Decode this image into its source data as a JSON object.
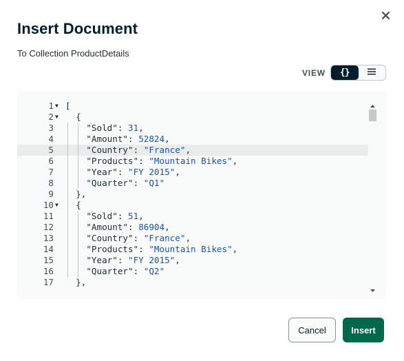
{
  "modal": {
    "title": "Insert Document",
    "subtitle": "To Collection ProductDetails",
    "close_icon": "close-icon"
  },
  "view_toggle": {
    "label": "VIEW",
    "options": [
      {
        "icon": "json-braces-icon",
        "glyph": "{}",
        "active": true
      },
      {
        "icon": "list-icon",
        "active": false
      }
    ]
  },
  "editor": {
    "highlighted_line": 5,
    "lines": [
      {
        "num": "1",
        "fold": true,
        "parts": [
          {
            "t": "p",
            "v": "["
          }
        ]
      },
      {
        "num": "2",
        "fold": true,
        "parts": [
          {
            "t": "p",
            "v": "  {"
          }
        ]
      },
      {
        "num": "3",
        "fold": false,
        "parts": [
          {
            "t": "p",
            "v": "    "
          },
          {
            "t": "k",
            "v": "\"Sold\""
          },
          {
            "t": "p",
            "v": ": "
          },
          {
            "t": "n",
            "v": "31"
          },
          {
            "t": "p",
            "v": ","
          }
        ]
      },
      {
        "num": "4",
        "fold": false,
        "parts": [
          {
            "t": "p",
            "v": "    "
          },
          {
            "t": "k",
            "v": "\"Amount\""
          },
          {
            "t": "p",
            "v": ": "
          },
          {
            "t": "n",
            "v": "52824"
          },
          {
            "t": "p",
            "v": ","
          }
        ]
      },
      {
        "num": "5",
        "fold": false,
        "parts": [
          {
            "t": "p",
            "v": "    "
          },
          {
            "t": "k",
            "v": "\"Country\""
          },
          {
            "t": "p",
            "v": ": "
          },
          {
            "t": "s",
            "v": "\"France\""
          },
          {
            "t": "p",
            "v": ","
          }
        ]
      },
      {
        "num": "6",
        "fold": false,
        "parts": [
          {
            "t": "p",
            "v": "    "
          },
          {
            "t": "k",
            "v": "\"Products\""
          },
          {
            "t": "p",
            "v": ": "
          },
          {
            "t": "s",
            "v": "\"Mountain Bikes\""
          },
          {
            "t": "p",
            "v": ","
          }
        ]
      },
      {
        "num": "7",
        "fold": false,
        "parts": [
          {
            "t": "p",
            "v": "    "
          },
          {
            "t": "k",
            "v": "\"Year\""
          },
          {
            "t": "p",
            "v": ": "
          },
          {
            "t": "s",
            "v": "\"FY 2015\""
          },
          {
            "t": "p",
            "v": ","
          }
        ]
      },
      {
        "num": "8",
        "fold": false,
        "parts": [
          {
            "t": "p",
            "v": "    "
          },
          {
            "t": "k",
            "v": "\"Quarter\""
          },
          {
            "t": "p",
            "v": ": "
          },
          {
            "t": "s",
            "v": "\"Q1\""
          }
        ]
      },
      {
        "num": "9",
        "fold": false,
        "parts": [
          {
            "t": "p",
            "v": "  },"
          }
        ]
      },
      {
        "num": "10",
        "fold": true,
        "parts": [
          {
            "t": "p",
            "v": "  {"
          }
        ]
      },
      {
        "num": "11",
        "fold": false,
        "parts": [
          {
            "t": "p",
            "v": "    "
          },
          {
            "t": "k",
            "v": "\"Sold\""
          },
          {
            "t": "p",
            "v": ": "
          },
          {
            "t": "n",
            "v": "51"
          },
          {
            "t": "p",
            "v": ","
          }
        ]
      },
      {
        "num": "12",
        "fold": false,
        "parts": [
          {
            "t": "p",
            "v": "    "
          },
          {
            "t": "k",
            "v": "\"Amount\""
          },
          {
            "t": "p",
            "v": ": "
          },
          {
            "t": "n",
            "v": "86904"
          },
          {
            "t": "p",
            "v": ","
          }
        ]
      },
      {
        "num": "13",
        "fold": false,
        "parts": [
          {
            "t": "p",
            "v": "    "
          },
          {
            "t": "k",
            "v": "\"Country\""
          },
          {
            "t": "p",
            "v": ": "
          },
          {
            "t": "s",
            "v": "\"France\""
          },
          {
            "t": "p",
            "v": ","
          }
        ]
      },
      {
        "num": "14",
        "fold": false,
        "parts": [
          {
            "t": "p",
            "v": "    "
          },
          {
            "t": "k",
            "v": "\"Products\""
          },
          {
            "t": "p",
            "v": ": "
          },
          {
            "t": "s",
            "v": "\"Mountain Bikes\""
          },
          {
            "t": "p",
            "v": ","
          }
        ]
      },
      {
        "num": "15",
        "fold": false,
        "parts": [
          {
            "t": "p",
            "v": "    "
          },
          {
            "t": "k",
            "v": "\"Year\""
          },
          {
            "t": "p",
            "v": ": "
          },
          {
            "t": "s",
            "v": "\"FY 2015\""
          },
          {
            "t": "p",
            "v": ","
          }
        ]
      },
      {
        "num": "16",
        "fold": false,
        "parts": [
          {
            "t": "p",
            "v": "    "
          },
          {
            "t": "k",
            "v": "\"Quarter\""
          },
          {
            "t": "p",
            "v": ": "
          },
          {
            "t": "s",
            "v": "\"Q2\""
          }
        ]
      },
      {
        "num": "17",
        "fold": false,
        "parts": [
          {
            "t": "p",
            "v": "  },"
          }
        ]
      }
    ]
  },
  "footer": {
    "cancel_label": "Cancel",
    "insert_label": "Insert"
  },
  "colors": {
    "primary_button": "#00684a",
    "title_text": "#001e2b",
    "string_value": "#1254b7",
    "toggle_active": "#001e2b"
  }
}
